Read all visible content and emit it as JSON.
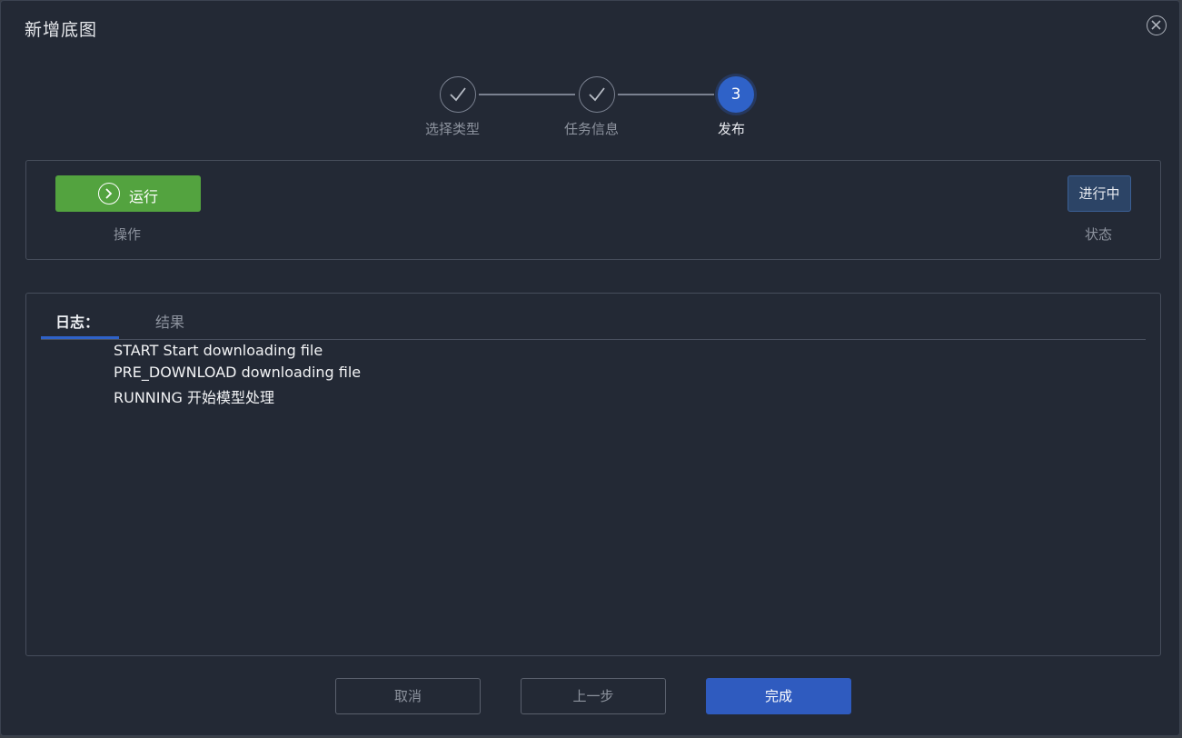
{
  "dialog": {
    "title": "新增底图"
  },
  "steps": [
    {
      "label": "选择类型",
      "state": "done"
    },
    {
      "label": "任务信息",
      "state": "done"
    },
    {
      "label": "发布",
      "state": "active",
      "number": "3"
    }
  ],
  "action_panel": {
    "run_label": "运行",
    "operation_caption": "操作",
    "status_value": "进行中",
    "status_caption": "状态"
  },
  "log_panel": {
    "tabs": [
      {
        "label": "日志：",
        "active": true
      },
      {
        "label": "结果",
        "active": false
      }
    ],
    "lines": [
      "START Start downloading file",
      "PRE_DOWNLOAD downloading file",
      "RUNNING 开始模型处理"
    ]
  },
  "footer": {
    "cancel_label": "取消",
    "prev_label": "上一步",
    "finish_label": "完成"
  },
  "colors": {
    "background": "#232935",
    "accent": "#2f62c8",
    "run_green": "#53a33f",
    "status_bg": "#2c4466"
  }
}
